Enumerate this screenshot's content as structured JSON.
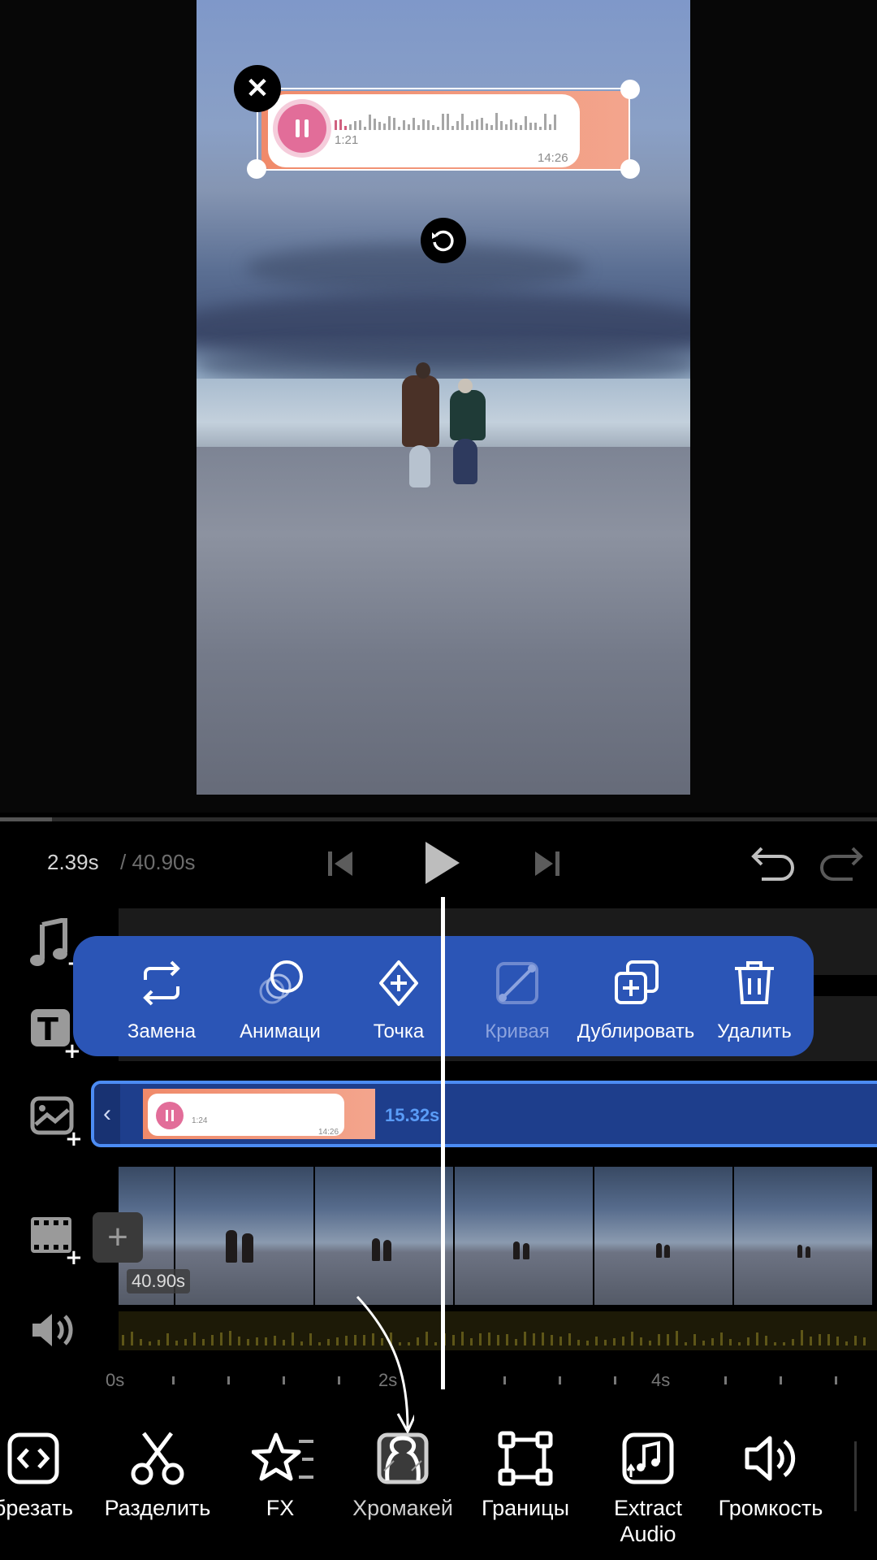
{
  "playback": {
    "current_time": "2.39s",
    "total_time": " / 40.90s"
  },
  "sticker": {
    "elapsed": "1:21",
    "clock": "14:26"
  },
  "context_menu": {
    "items": [
      {
        "label": "Замена",
        "icon": "replace-icon"
      },
      {
        "label": "Анимаци",
        "icon": "animation-icon"
      },
      {
        "label": "Точка",
        "icon": "keyframe-icon"
      },
      {
        "label": "Кривая",
        "icon": "curve-icon",
        "disabled": true
      },
      {
        "label": "Дублировать",
        "icon": "duplicate-icon"
      },
      {
        "label": "Удалить",
        "icon": "delete-icon"
      }
    ]
  },
  "overlay_clip": {
    "duration": "15.32s",
    "thumb_elapsed": "1:24",
    "thumb_clock": "14:26"
  },
  "video_track": {
    "duration": "40.90s"
  },
  "ruler": {
    "labels": [
      "0s",
      "2s",
      "4s"
    ]
  },
  "toolbar": {
    "items": [
      {
        "label": "брезать",
        "icon": "trim-icon"
      },
      {
        "label": "Разделить",
        "icon": "scissors-icon"
      },
      {
        "label": "FX",
        "icon": "fx-star-icon"
      },
      {
        "label": "Хромакей",
        "icon": "chroma-key-icon"
      },
      {
        "label": "Границы",
        "icon": "crop-bounds-icon"
      },
      {
        "label": "Extract Audio",
        "icon": "extract-audio-icon"
      },
      {
        "label": "Громкость",
        "icon": "volume-icon"
      }
    ]
  },
  "colors": {
    "menu_bg": "#2b55b6",
    "selection": "#4c8cf4",
    "sticker_accent": "#e26d99"
  }
}
